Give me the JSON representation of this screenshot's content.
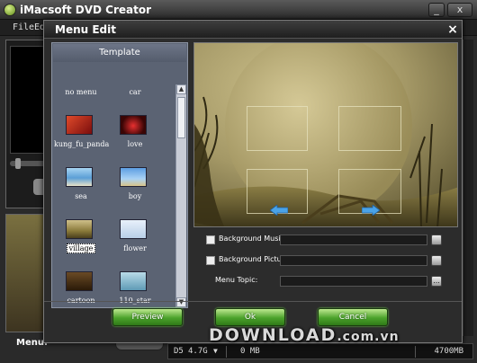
{
  "app": {
    "title": "iMacsoft DVD Creator",
    "menu": [
      "File",
      "Edit"
    ],
    "menu_label": "Menu:",
    "window_controls": {
      "minimize": "_",
      "close": "x"
    }
  },
  "dialog": {
    "title": "Menu Edit",
    "close": "×",
    "template_panel": {
      "header": "Template",
      "items": [
        {
          "label": "no menu",
          "thumb": "none"
        },
        {
          "label": "car",
          "thumb": "none"
        },
        {
          "label": "kung_fu_panda",
          "thumb": "#b51e1e"
        },
        {
          "label": "love",
          "thumb": "#9b1515"
        },
        {
          "label": "sea",
          "thumb": "#7fb8e6"
        },
        {
          "label": "boy",
          "thumb": "#6fa8e0"
        },
        {
          "label": "village",
          "thumb": "#8a7a3a",
          "selected": true
        },
        {
          "label": "flower",
          "thumb": "#c8d8f0"
        },
        {
          "label": "cartoon",
          "thumb": "#5a3a1a"
        },
        {
          "label": "110_star",
          "thumb": "#8fbccf"
        }
      ]
    },
    "fields": {
      "background_music": {
        "label": "Background Music:",
        "value": ""
      },
      "background_picture": {
        "label": "Background Picture:",
        "value": ""
      },
      "menu_topic": {
        "label": "Menu Topic:",
        "value": "",
        "button": "..."
      }
    },
    "buttons": {
      "preview": "Preview",
      "ok": "Ok",
      "cancel": "Cancel"
    }
  },
  "status": {
    "disc": "D5",
    "size": "4.7G",
    "used": "0 MB",
    "capacity": "4700MB"
  },
  "watermark": {
    "main": "DOWNLOAD",
    "suffix": ".com.vn"
  },
  "colors": {
    "button_green": "#4ba22b",
    "template_panel_bg": "#5b6373",
    "sepia_sky": "#b8ab72"
  }
}
